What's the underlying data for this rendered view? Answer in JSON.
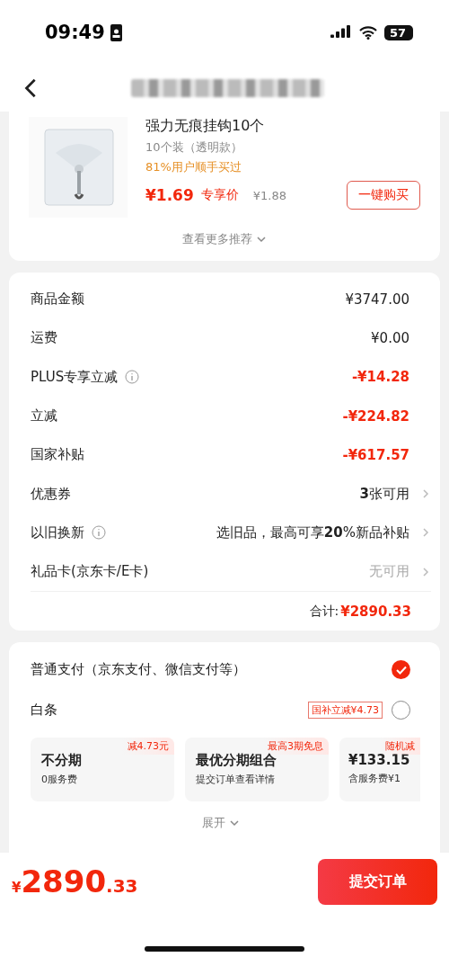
{
  "status_bar": {
    "time": "09:49",
    "battery": "57"
  },
  "product": {
    "name": "强力无痕挂钩10个",
    "spec": "10个装（透明款）",
    "note": "81%用户顺手买过",
    "price": "¥1.69",
    "price_label": "专享价",
    "original_price": "¥1.88",
    "buy_button": "一键购买",
    "more": "查看更多推荐"
  },
  "summary": {
    "rows": [
      {
        "label": "商品金额",
        "value": "¥3747.00",
        "kind": "normal",
        "info": false,
        "chevron": false
      },
      {
        "label": "运费",
        "value": "¥0.00",
        "kind": "normal",
        "info": false,
        "chevron": false
      },
      {
        "label": "PLUS专享立减",
        "value": "-¥14.28",
        "kind": "discount",
        "info": true,
        "chevron": false
      },
      {
        "label": "立减",
        "value": "-¥224.82",
        "kind": "discount",
        "info": false,
        "chevron": false
      },
      {
        "label": "国家补贴",
        "value": "-¥617.57",
        "kind": "discount",
        "info": false,
        "chevron": false
      },
      {
        "label": "优惠券",
        "value": "**3**张可用",
        "kind": "normal",
        "info": false,
        "chevron": true
      },
      {
        "label": "以旧换新",
        "value": "选旧品，最高可享**20**%新品补贴",
        "kind": "normal",
        "info": true,
        "chevron": true
      },
      {
        "label": "礼品卡(京东卡/E卡)",
        "value": "无可用",
        "kind": "muted",
        "info": false,
        "chevron": true
      }
    ],
    "total_label": "合计:",
    "total": "¥2890.33"
  },
  "payment": {
    "methods": [
      {
        "label": "普通支付（京东支付、微信支付等）",
        "selected": true
      },
      {
        "label": "白条",
        "tag": "国补立减¥4.73",
        "selected": false
      }
    ],
    "plans": [
      {
        "badge": "减4.73元",
        "title": "不分期",
        "subtitle": "0服务费"
      },
      {
        "badge": "最高3期免息",
        "title": "最优分期组合",
        "subtitle": "提交订单查看详情"
      },
      {
        "badge": "随机减",
        "title": "¥133.15",
        "subtitle": "含服务费¥1"
      }
    ],
    "expand": "展开"
  },
  "footer": {
    "total": "¥2890.33",
    "submit": "提交订单"
  }
}
